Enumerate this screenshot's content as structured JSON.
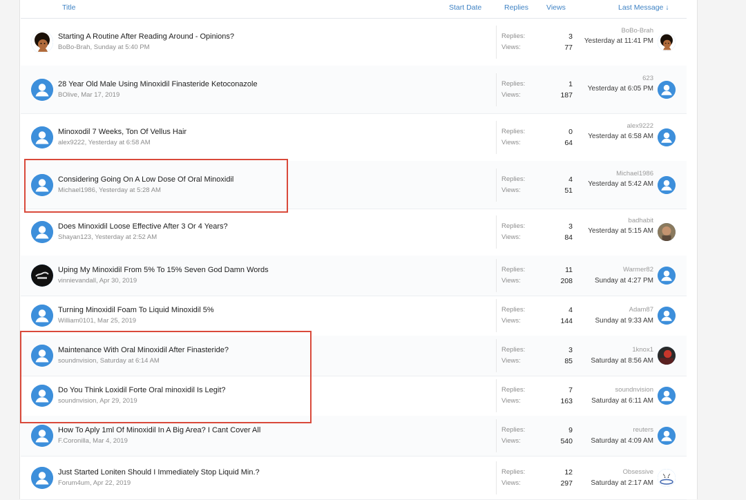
{
  "header": {
    "title": "Title",
    "start_date": "Start Date",
    "replies": "Replies",
    "views": "Views",
    "last_message": "Last Message ↓"
  },
  "labels": {
    "replies": "Replies:",
    "views": "Views:"
  },
  "threads": [
    {
      "title": "Starting A Routine After Reading Around - Opinions?",
      "author": "BoBo-Brah",
      "start": "Sunday at 5:40 PM",
      "replies": "3",
      "views": "77",
      "last_user": "BoBo-Brah",
      "last_date": "Yesterday at 11:41 PM",
      "avatar": "custom-face",
      "last_avatar": "custom-face"
    },
    {
      "title": "28 Year Old Male Using Minoxidil Finasteride Ketoconazole",
      "author": "BOlive",
      "start": "Mar 17, 2019",
      "replies": "1",
      "views": "187",
      "last_user": "623",
      "last_date": "Yesterday at 6:05 PM",
      "avatar": "default-user",
      "last_avatar": "default-user"
    },
    {
      "title": "Minoxodil 7 Weeks, Ton Of Vellus Hair",
      "author": "alex9222",
      "start": "Yesterday at 6:58 AM",
      "replies": "0",
      "views": "64",
      "last_user": "alex9222",
      "last_date": "Yesterday at 6:58 AM",
      "avatar": "default-user",
      "last_avatar": "default-user"
    },
    {
      "title": "Considering Going On A Low Dose Of Oral Minoxidil",
      "author": "Michael1986",
      "start": "Yesterday at 5:28 AM",
      "replies": "4",
      "views": "51",
      "last_user": "Michael1986",
      "last_date": "Yesterday at 5:42 AM",
      "avatar": "default-user",
      "last_avatar": "default-user"
    },
    {
      "title": "Does Minoxidil Loose Effective After 3 Or 4 Years?",
      "author": "Shayan123",
      "start": "Yesterday at 2:52 AM",
      "replies": "3",
      "views": "84",
      "last_user": "badhabit",
      "last_date": "Yesterday at 5:15 AM",
      "avatar": "default-user",
      "last_avatar": "photo-face"
    },
    {
      "title": "Uping My Minoxidil From 5% To 15% Seven God Damn Words",
      "author": "vinnievandall",
      "start": "Apr 30, 2019",
      "replies": "11",
      "views": "208",
      "last_user": "Warmer82",
      "last_date": "Sunday at 4:27 PM",
      "avatar": "dark-logo",
      "last_avatar": "default-user"
    },
    {
      "title": "Turning Minoxidil Foam To Liquid Minoxidil 5%",
      "author": "William0101",
      "start": "Mar 25, 2019",
      "replies": "4",
      "views": "144",
      "last_user": "Adam87",
      "last_date": "Sunday at 9:33 AM",
      "avatar": "default-user",
      "last_avatar": "default-user"
    },
    {
      "title": "Maintenance With Oral Minoxidil After Finasteride?",
      "author": "soundnvision",
      "start": "Saturday at 6:14 AM",
      "replies": "3",
      "views": "85",
      "last_user": "1knox1",
      "last_date": "Saturday at 8:56 AM",
      "avatar": "default-user",
      "last_avatar": "red-photo"
    },
    {
      "title": "Do You Think Loxidil Forte Oral minoxidil Is Legit?",
      "author": "soundnvision",
      "start": "Apr 29, 2019",
      "replies": "7",
      "views": "163",
      "last_user": "soundnvision",
      "last_date": "Saturday at 6:11 AM",
      "avatar": "default-user",
      "last_avatar": "default-user"
    },
    {
      "title": "How To Aply 1ml Of Minoxidil In A Big Area? I Cant Cover All",
      "author": "F.Coronilla",
      "start": "Mar 4, 2019",
      "replies": "9",
      "views": "540",
      "last_user": "reuters",
      "last_date": "Saturday at 4:09 AM",
      "avatar": "default-user",
      "last_avatar": "default-user"
    },
    {
      "title": "Just Started Loniten Should I Immediately Stop Liquid Min.?",
      "author": "Forum4um",
      "start": "Apr 22, 2019",
      "replies": "12",
      "views": "297",
      "last_user": "Obsessive",
      "last_date": "Saturday at 2:17 AM",
      "avatar": "default-user",
      "last_avatar": "sketch-face"
    }
  ],
  "colors": {
    "link": "#3e82c4",
    "avatar": "#3d8fdb",
    "highlight": "#d9493a"
  }
}
